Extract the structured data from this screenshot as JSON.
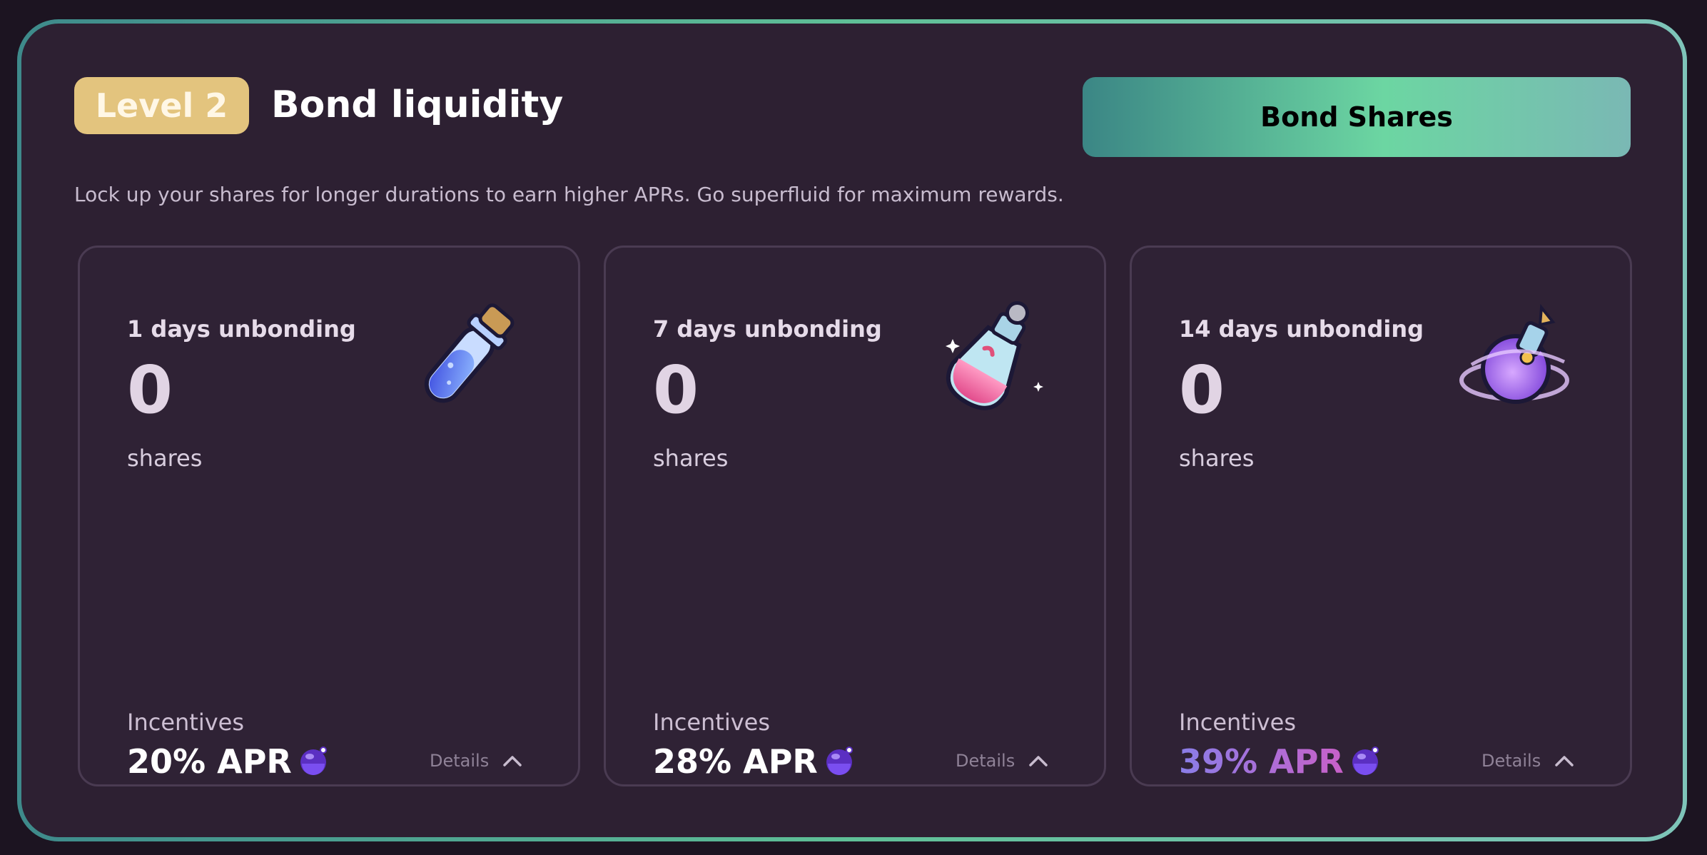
{
  "header": {
    "level_badge": "Level 2",
    "title": "Bond liquidity",
    "subtitle": "Lock up your shares for longer durations to earn higher APRs. Go superfluid for maximum rewards.",
    "bond_button": "Bond Shares"
  },
  "cards": [
    {
      "period": "1 days unbonding",
      "amount": "0",
      "unit": "shares",
      "incentives_label": "Incentives",
      "apr": "20% APR",
      "details_label": "Details",
      "icon": "blue-vial-potion-icon"
    },
    {
      "period": "7 days unbonding",
      "amount": "0",
      "unit": "shares",
      "incentives_label": "Incentives",
      "apr": "28% APR",
      "details_label": "Details",
      "icon": "pink-flask-potion-icon"
    },
    {
      "period": "14 days unbonding",
      "amount": "0",
      "unit": "shares",
      "incentives_label": "Incentives",
      "apr": "39% APR",
      "details_label": "Details",
      "icon": "purple-swirl-potion-icon"
    }
  ],
  "colors": {
    "background": "#1c1421",
    "panel": "#2d2032",
    "badge": "#e3c47e",
    "accent_green": "#6cd6a2"
  }
}
